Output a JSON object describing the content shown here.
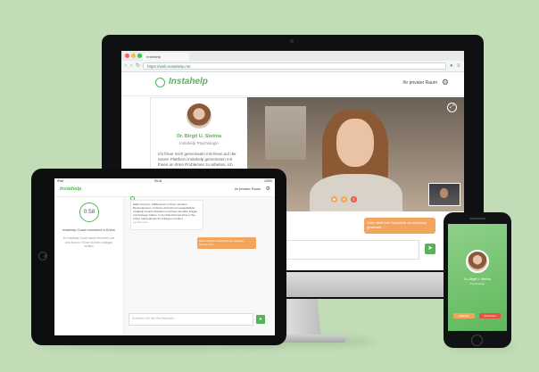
{
  "browser": {
    "tab_label": "Instahelp",
    "url": "https://web.instahelp.me",
    "back_icon": "back-arrow-icon",
    "forward_icon": "forward-arrow-icon",
    "reload_icon": "reload-icon"
  },
  "app": {
    "logo_text": "Instahelp",
    "room_label": "Ihr privater Raum",
    "brand_color": "#57b25b",
    "accent_color": "#f3a55e"
  },
  "profile": {
    "name": "Dr. Birgit U. Stetina",
    "role": "Instahelp Psychologin",
    "bio": "Ich freue mich gemeinsam mit Ihnen auf der neuen Plattform Instahelp gemeinsam mit Ihnen an Ihren Problemen zu arbeiten, ich werde mich sehr"
  },
  "desktop_chat": {
    "outgoing_message": "Oder stellt Ihre Nachricht an Instahelp gesendet",
    "input_placeholder": "Ihre Nachricht"
  },
  "tablet": {
    "status_left": "iPad",
    "status_center": "09:41",
    "status_right": "100%",
    "logo_text": "Instahelp",
    "room_label": "Ihr privater Raum",
    "timer": "0:58",
    "coach_title": "Instahelp Coach erscheint in Kürze",
    "coach_desc": "Ihr Instahelp Coach wurde informiert und wird Ihnen in Kürze für Ihren Anliegen melden",
    "incoming_message": "Hallo! Anonym. Willkommen in Ihrem privaten Beratungsraum. In Kürze wird sich ein ausgebildeter Instahelp Coach verbinden und Ihnen bei allen Fragen und Anliegen helfen. In der Zwischenzeit können Sie schon mal beginnen Ihr Anliegen zu teilen.",
    "incoming_time": "gerade eben",
    "outgoing_message": "Oder stellt Ihre Nachricht an Instahelp",
    "outgoing_time": "gerade eben",
    "input_placeholder": "Schreiben Sie hier Ihre Nachricht"
  },
  "phone": {
    "name": "Dr. Birgit U. Stetina",
    "role": "Psychologin",
    "decline_label": "Ablehnen",
    "accept_label": "Annehmen"
  }
}
